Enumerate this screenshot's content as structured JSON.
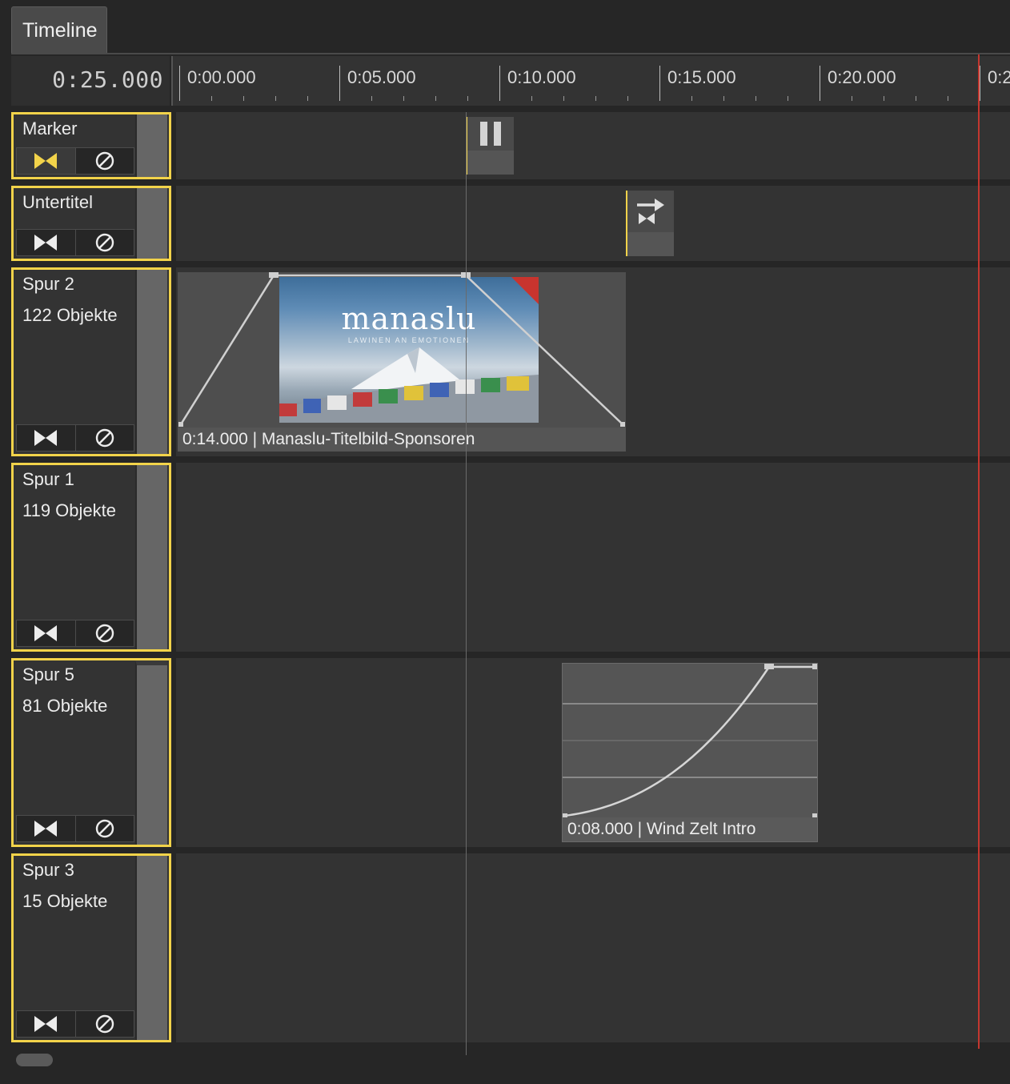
{
  "panel": {
    "tab_label": "Timeline"
  },
  "timecode": "0:25.000",
  "ruler": {
    "labels": [
      "0:00.000",
      "0:05.000",
      "0:10.000",
      "0:15.000",
      "0:20.000",
      "0:2"
    ]
  },
  "tracks": [
    {
      "title": "Marker",
      "count": ""
    },
    {
      "title": "Untertitel",
      "count": ""
    },
    {
      "title": "Spur 2",
      "count": "122 Objekte"
    },
    {
      "title": "Spur 1",
      "count": "119 Objekte"
    },
    {
      "title": "Spur 5",
      "count": "81 Objekte"
    },
    {
      "title": "Spur 3",
      "count": "15 Objekte"
    }
  ],
  "clips": {
    "video": {
      "label": "0:14.000 | Manaslu-Titelbild-Sponsoren",
      "thumb_title": "manaslu",
      "thumb_subtitle": "LAWINEN AN EMOTIONEN"
    },
    "audio": {
      "label": "0:08.000 | Wind Zelt Intro"
    }
  },
  "icons": {
    "marker_pause": "pause-icon",
    "subtitle_transition": "transition-arrow-icon",
    "follow": "bowtie-icon",
    "disable": "no-entry-icon"
  },
  "colors": {
    "accent": "#f2d34a",
    "end_line": "#c4372f",
    "background": "#262626",
    "lane": "#333333"
  }
}
